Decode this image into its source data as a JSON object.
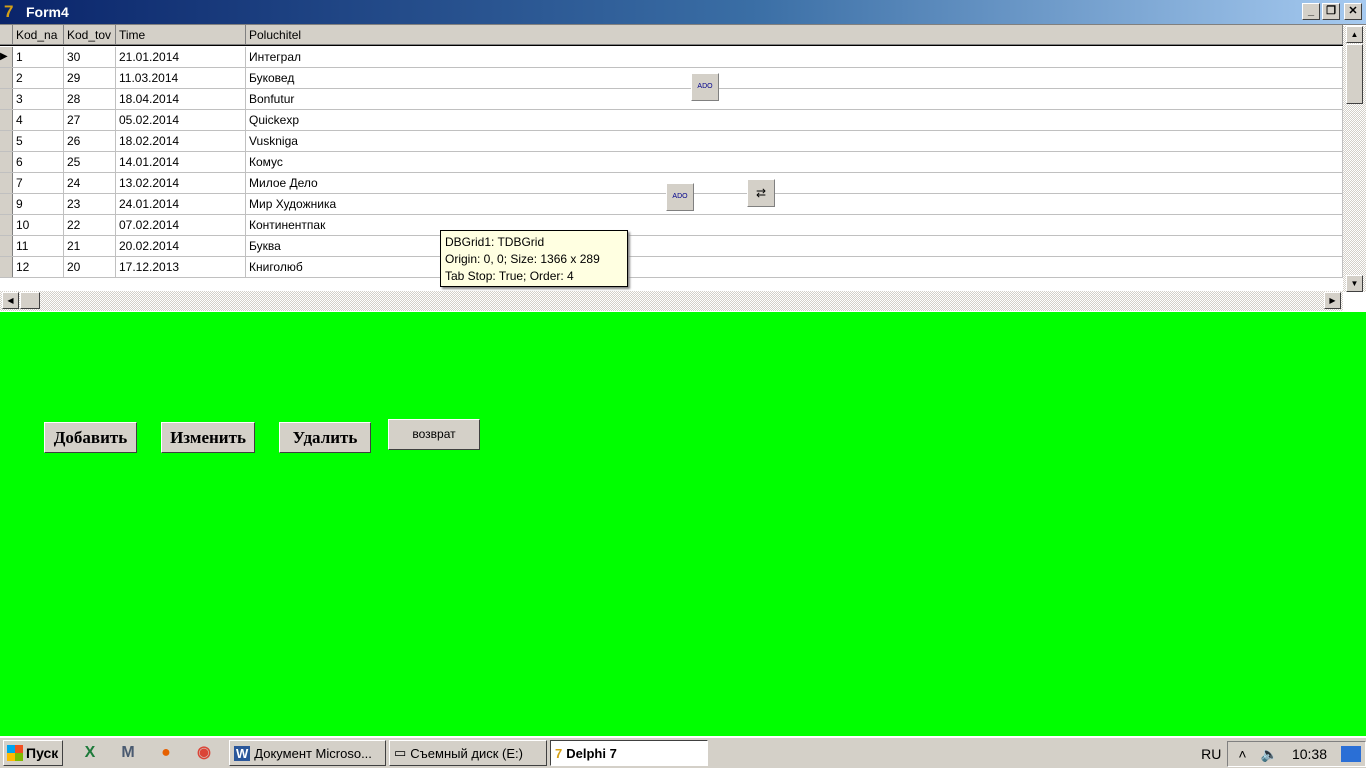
{
  "window": {
    "title": "Form4",
    "min": "_",
    "restore": "❐",
    "close": "✕"
  },
  "grid": {
    "columns": [
      "Kod_na",
      "Kod_tov",
      "Time",
      "Poluchitel"
    ],
    "rows": [
      [
        "1",
        "30",
        "21.01.2014",
        "Интеграл"
      ],
      [
        "2",
        "29",
        "11.03.2014",
        "Буковед"
      ],
      [
        "3",
        "28",
        "18.04.2014",
        "Bonfutur"
      ],
      [
        "4",
        "27",
        "05.02.2014",
        "Quickexp"
      ],
      [
        "5",
        "26",
        "18.02.2014",
        "Vusknіga"
      ],
      [
        "6",
        "25",
        "14.01.2014",
        "Комус"
      ],
      [
        "7",
        "24",
        "13.02.2014",
        "Милое Дело"
      ],
      [
        "9",
        "23",
        "24.01.2014",
        "Мир Художника"
      ],
      [
        "10",
        "22",
        "07.02.2014",
        "Континентпак"
      ],
      [
        "11",
        "21",
        "20.02.2014",
        "Буква"
      ],
      [
        "12",
        "20",
        "17.12.2013",
        "Книголюб"
      ]
    ]
  },
  "components": {
    "ado_label": "ADO"
  },
  "tooltip": {
    "line1": "DBGrid1: TDBGrid",
    "line2": "Origin: 0, 0; Size: 1366 x 289",
    "line3": "Tab Stop: True; Order: 4"
  },
  "buttons": {
    "add": "Добавить",
    "edit": "Изменить",
    "delete": "Удалить",
    "back": "возврат"
  },
  "taskbar": {
    "start": "Пуск",
    "tasks": [
      "Документ Microso...",
      "Съемный диск (E:)",
      "Delphi 7"
    ],
    "lang": "RU",
    "time": "10:38"
  }
}
